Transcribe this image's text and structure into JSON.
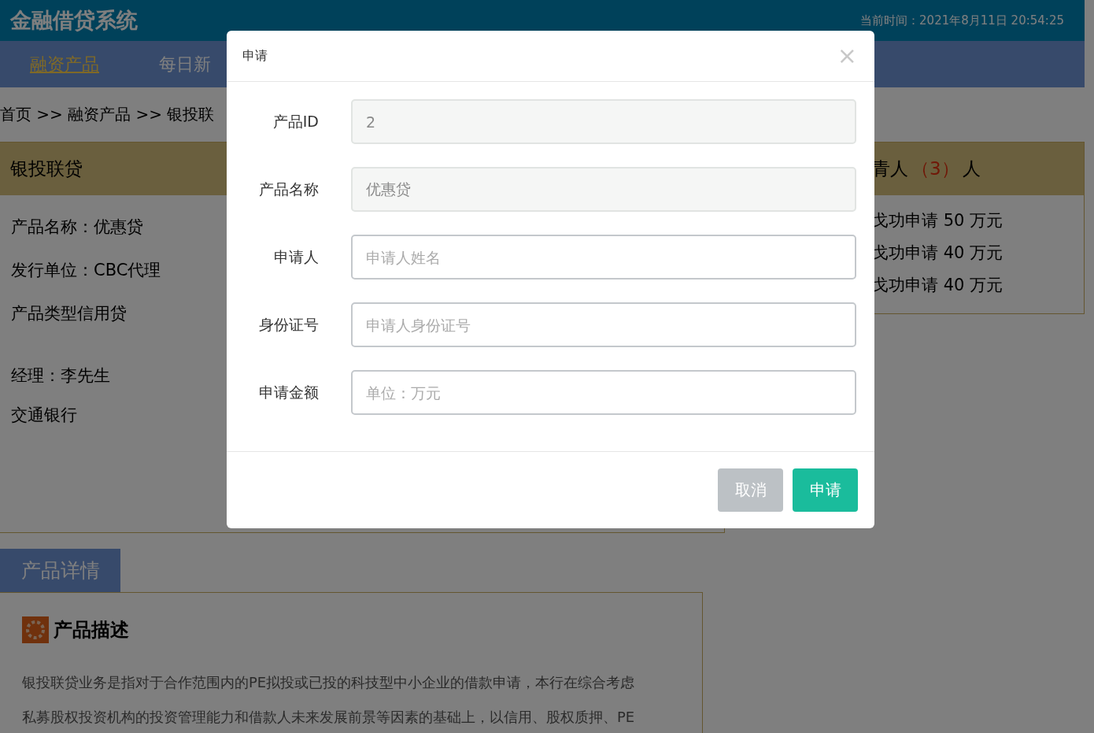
{
  "header": {
    "title": "金融借贷系统",
    "time": "当前时间：2021年8月11日 20:54:25"
  },
  "nav": [
    {
      "label": "融资产品",
      "selected": true
    },
    {
      "label": "每日新",
      "selected": false
    }
  ],
  "breadcrumb": "首页 >> 融资产品 >> 银投联",
  "product": {
    "title": "银投联贷",
    "lines": [
      "产品名称：优惠贷",
      "发行单位：CBC代理",
      "产品类型信用贷"
    ],
    "manager": "经理：李先生",
    "bank": "交通银行"
  },
  "applicants": {
    "title_prefix": "青人",
    "count": "（3）",
    "title_suffix": "人",
    "rows": [
      "戈功申请 50 万元",
      "戈功申请 40 万元",
      "戈功申请 40 万元"
    ]
  },
  "details_tab": "产品详情",
  "description": {
    "title": "产品描述",
    "lines": [
      "银投联贷业务是指对于合作范围内的PE拟投或已投的科技型中小企业的借款申请，本行在综合考虑",
      "私募股权投资机构的投资管理能力和借款人未来发展前景等因素的基础上，以信用、股权质押、PE"
    ]
  },
  "dialog": {
    "title": "申请",
    "close": "×",
    "fields": [
      {
        "label": "产品ID",
        "value": "2",
        "disabled": true
      },
      {
        "label": "产品名称",
        "value": "优惠贷",
        "disabled": true
      },
      {
        "label": "申请人",
        "placeholder": "申请人姓名",
        "disabled": false
      },
      {
        "label": "身份证号",
        "placeholder": "申请人身份证号",
        "disabled": false
      },
      {
        "label": "申请金额",
        "placeholder": "单位：万元",
        "disabled": false
      }
    ],
    "buttons": [
      {
        "label": "取消",
        "kind": "secondary"
      },
      {
        "label": "申请",
        "kind": "primary"
      }
    ]
  }
}
